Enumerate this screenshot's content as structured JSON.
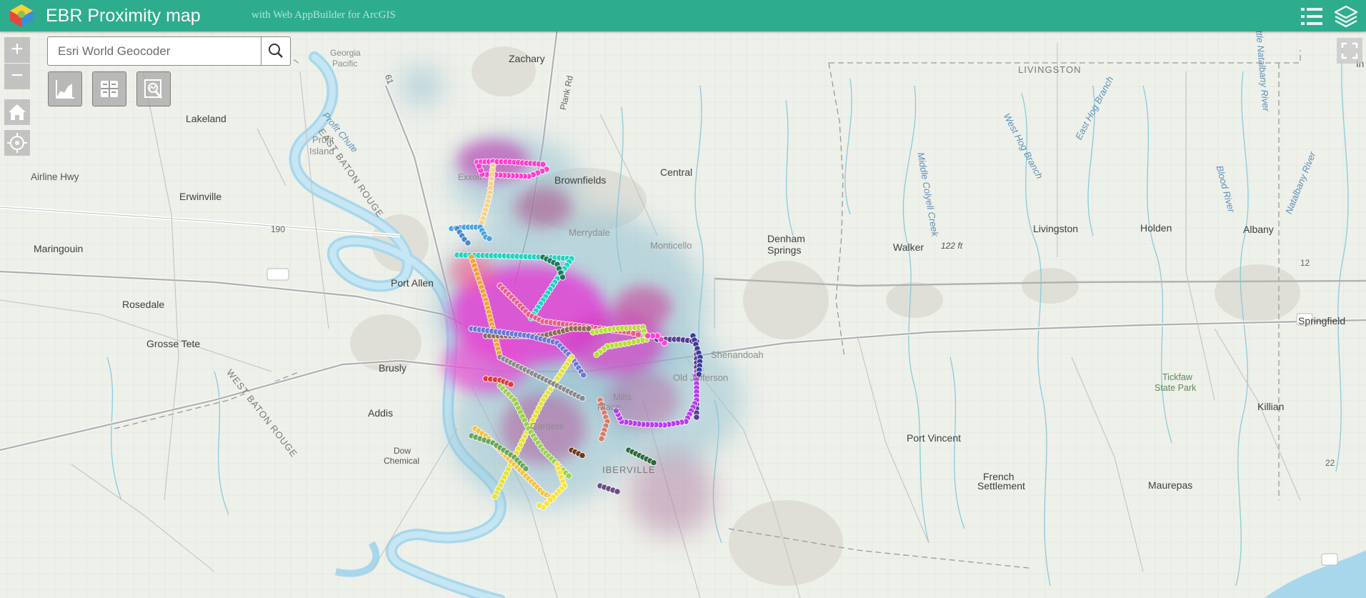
{
  "header": {
    "title": "EBR Proximity map",
    "subtitle": "with Web AppBuilder for ArcGIS",
    "widget_icons": [
      "list-icon",
      "layers-icon"
    ],
    "background_color": "#2eac8e"
  },
  "search": {
    "placeholder": "Esri World Geocoder",
    "button_icon": "search-icon"
  },
  "controls": {
    "zoom_in": "+",
    "zoom_out": "−",
    "home_icon": "home-icon",
    "locate_icon": "locate-icon",
    "fullscreen_icon": "fullscreen-icon"
  },
  "toolbar": {
    "tools": [
      {
        "icon": "chart-icon"
      },
      {
        "icon": "grid-icon"
      },
      {
        "icon": "query-icon"
      }
    ]
  },
  "map": {
    "labels": {
      "zachary": "Zachary",
      "georgia_pacific_1": "Georgia",
      "georgia_pacific_2": "Pacific",
      "livingston_parish": "LIVINGSTON",
      "lakeland": "Lakeland",
      "profit_island_1": "Profit",
      "profit_island_2": "Island",
      "east_baton_rouge": "EAST BATON ROUGE",
      "profit_chute": "Profit Chute",
      "airline_hwy": "Airline Hwy",
      "erwinville": "Erwinville",
      "brownfields": "Brownfields",
      "central": "Central",
      "merrydale": "Merrydale",
      "monticello": "Monticello",
      "maringouin": "Maringouin",
      "denham_springs_1": "Denham",
      "denham_springs_2": "Springs",
      "walker": "Walker",
      "elevation": "122 ft",
      "livingston_town": "Livingston",
      "holden": "Holden",
      "albany": "Albany",
      "port_allen": "Port Allen",
      "rosedale": "Rosedale",
      "springfield": "Springfield",
      "grosse_tete": "Grosse Tete",
      "shenandoah": "Shenandoah",
      "brusly": "Brusly",
      "old_jefferson": "Old Jefferson",
      "west_baton_rouge": "WEST BATON ROUGE",
      "tickfaw_1": "Tickfaw",
      "tickfaw_2": "State Park",
      "addis": "Addis",
      "killian": "Killian",
      "gardere": "Gardere",
      "port_vincent": "Port Vincent",
      "dow_chemical_1": "Dow",
      "dow_chemical_2": "Chemical",
      "iberville": "IBERVILLE",
      "french_settlement_1": "French",
      "french_settlement_2": "Settlement",
      "maurepas": "Maurepas",
      "west_hog_branch": "West Hog Branch",
      "east_hog_branch": "East Hog Branch",
      "middle_colyell": "Middle Colyell Creek",
      "blood_river": "Blood River",
      "natalbany_river": "Natalbany River",
      "natalbany_river_north": "ttle Natalbany River",
      "plank_rd": "Plank Rd",
      "route_190": "190",
      "route_12": "12",
      "route_22": "22",
      "route_61": "61",
      "exxon": "Exxon",
      "place": "Place",
      "mills": "Mills",
      "edge_letter": "In"
    }
  }
}
